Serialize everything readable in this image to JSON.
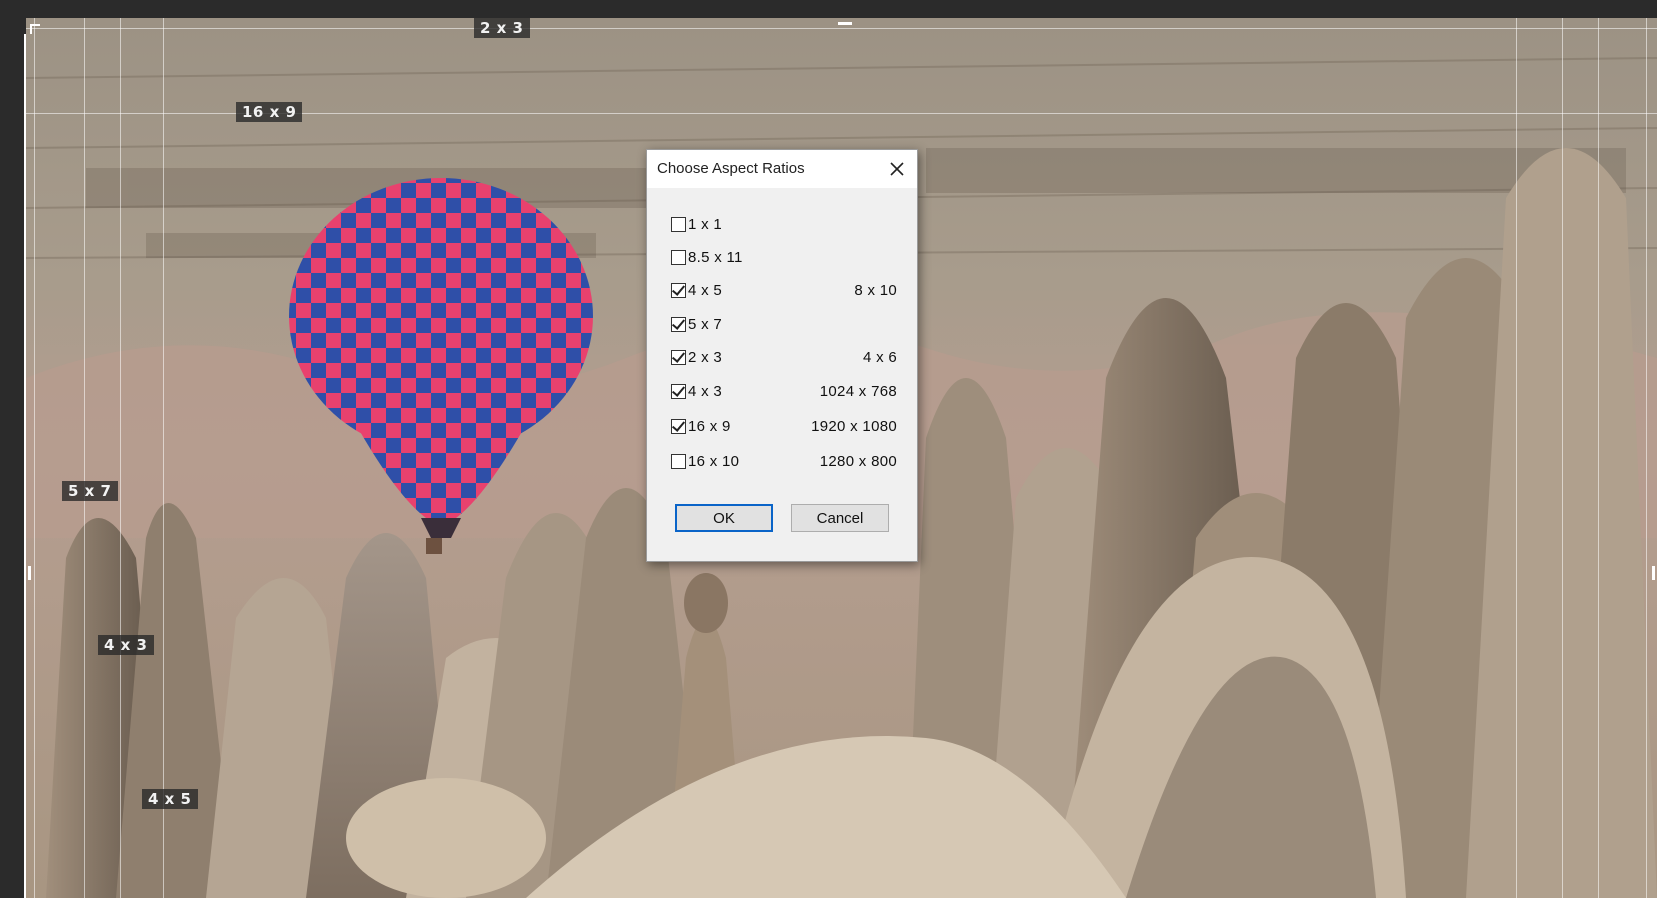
{
  "dialog": {
    "title": "Choose Aspect Ratios",
    "close_icon": "close-icon",
    "options": [
      {
        "label": "1 x 1",
        "alt": "",
        "checked": false
      },
      {
        "label": "8.5 x 11",
        "alt": "",
        "checked": false
      },
      {
        "label": "4 x 5",
        "alt": "8 x 10",
        "checked": true
      },
      {
        "label": "5 x 7",
        "alt": "",
        "checked": true
      },
      {
        "label": "2 x 3",
        "alt": "4 x 6",
        "checked": true
      },
      {
        "label": "4 x 3",
        "alt": "1024 x 768",
        "checked": true
      },
      {
        "label": "16 x 9",
        "alt": "1920 x 1080",
        "checked": true
      },
      {
        "label": "16 x 10",
        "alt": "1280 x 800",
        "checked": false
      }
    ],
    "ok_label": "OK",
    "cancel_label": "Cancel"
  },
  "crop_overlay": {
    "labels": {
      "ratio_2x3": "2 x 3",
      "ratio_16x9": "16 x 9",
      "ratio_5x7": "5 x 7",
      "ratio_4x3": "4 x 3",
      "ratio_4x5": "4 x 5"
    }
  },
  "colors": {
    "ok_focus_border": "#0a64c8",
    "balloon_pink": "#e8416e",
    "balloon_blue": "#2f4fa8"
  }
}
